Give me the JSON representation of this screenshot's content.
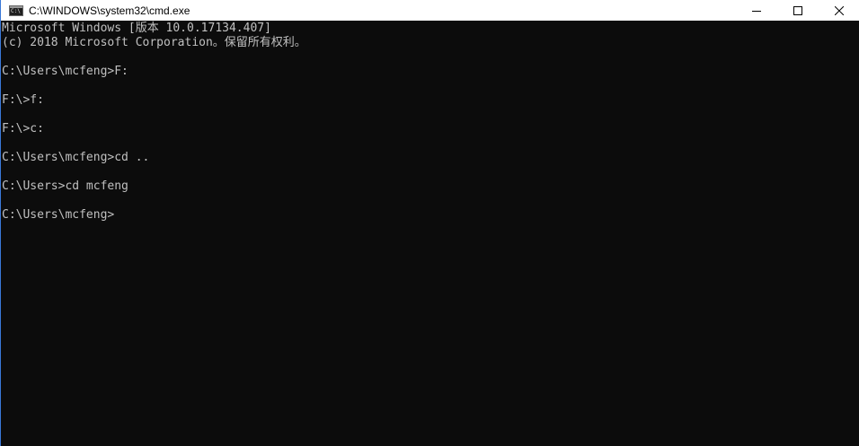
{
  "window": {
    "title": "C:\\WINDOWS\\system32\\cmd.exe",
    "icon": "cmd-icon",
    "icon_text": "C:\\",
    "controls": {
      "minimize": "minimize-icon",
      "maximize": "maximize-icon",
      "close": "close-icon"
    }
  },
  "console": {
    "lines": [
      "Microsoft Windows [版本 10.0.17134.407]",
      "(c) 2018 Microsoft Corporation。保留所有权利。",
      "",
      "C:\\Users\\mcfeng>F:",
      "",
      "F:\\>f:",
      "",
      "F:\\>c:",
      "",
      "C:\\Users\\mcfeng>cd ..",
      "",
      "C:\\Users>cd mcfeng",
      "",
      "C:\\Users\\mcfeng>"
    ]
  },
  "colors": {
    "background": "#0c0c0c",
    "text": "#c0c0c0",
    "titlebar": "#ffffff",
    "accent_border": "#3a78d8"
  }
}
